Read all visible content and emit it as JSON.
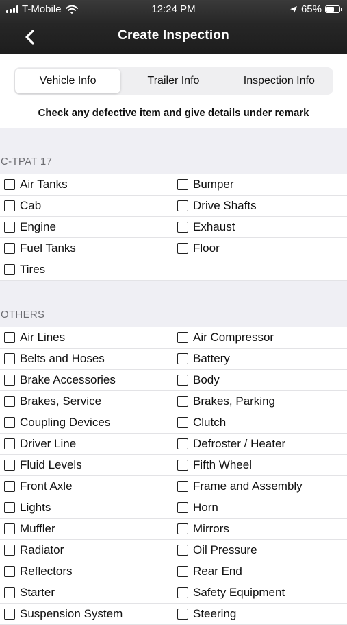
{
  "status_bar": {
    "carrier": "T-Mobile",
    "time": "12:24 PM",
    "battery_percent": "65%",
    "battery_level": 0.65,
    "icons": [
      "signal-icon",
      "wifi-icon",
      "location-arrow-icon",
      "battery-icon"
    ]
  },
  "nav": {
    "title": "Create Inspection",
    "back_icon": "chevron-left-icon"
  },
  "tabs": [
    {
      "label": "Vehicle Info",
      "active": true
    },
    {
      "label": "Trailer Info",
      "active": false
    },
    {
      "label": "Inspection Info",
      "active": false
    }
  ],
  "instruction": "Check any defective item and give details under remark",
  "sections": [
    {
      "title": "C-TPAT 17",
      "rows": [
        [
          "Air Tanks",
          "Bumper"
        ],
        [
          "Cab",
          "Drive Shafts"
        ],
        [
          "Engine",
          "Exhaust"
        ],
        [
          "Fuel Tanks",
          "Floor"
        ],
        [
          "Tires",
          ""
        ]
      ]
    },
    {
      "title": "OTHERS",
      "rows": [
        [
          "Air Lines",
          "Air Compressor"
        ],
        [
          "Belts and Hoses",
          "Battery"
        ],
        [
          "Brake Accessories",
          "Body"
        ],
        [
          "Brakes, Service",
          "Brakes, Parking"
        ],
        [
          "Coupling Devices",
          "Clutch"
        ],
        [
          "Driver Line",
          "Defroster / Heater"
        ],
        [
          "Fluid Levels",
          "Fifth Wheel"
        ],
        [
          "Front Axle",
          "Frame and Assembly"
        ],
        [
          "Lights",
          "Horn"
        ],
        [
          "Muffler",
          "Mirrors"
        ],
        [
          "Radiator",
          "Oil Pressure"
        ],
        [
          "Reflectors",
          "Rear End"
        ],
        [
          "Starter",
          "Safety Equipment"
        ],
        [
          "Suspension System",
          "Steering"
        ]
      ]
    }
  ]
}
